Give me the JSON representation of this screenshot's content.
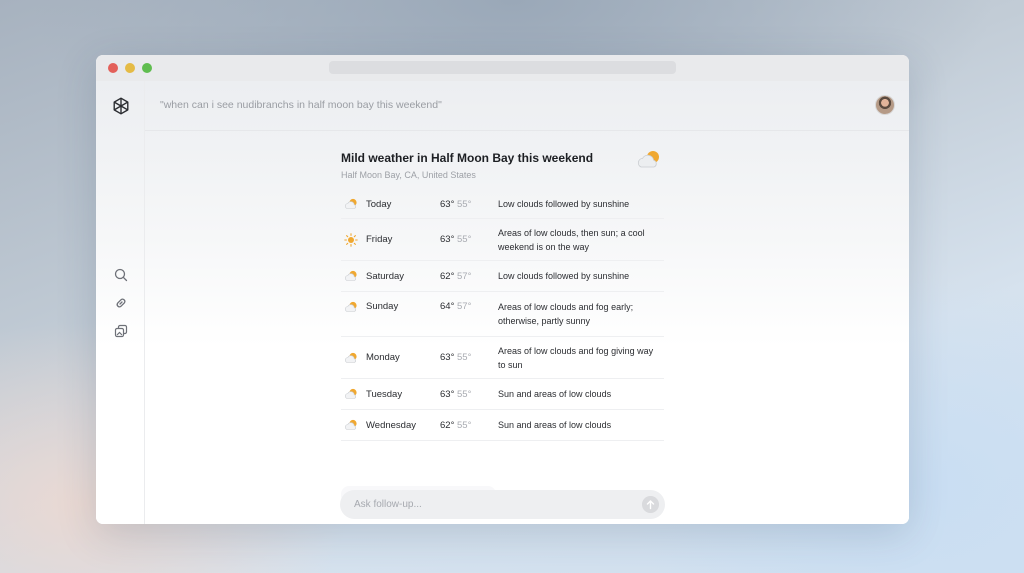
{
  "app": {
    "query": "\"when can i see nudibranchs in half moon bay this weekend\""
  },
  "weather": {
    "title": "Mild weather in Half Moon Bay this weekend",
    "location": "Half Moon Bay, CA, United States",
    "days": [
      {
        "day": "Today",
        "hi": "63°",
        "lo": "55°",
        "desc": "Low clouds followed by sunshine",
        "icon": "partly-cloudy-icon"
      },
      {
        "day": "Friday",
        "hi": "63°",
        "lo": "55°",
        "desc": "Areas of low clouds, then sun; a cool weekend is on the way",
        "icon": "sun-icon"
      },
      {
        "day": "Saturday",
        "hi": "62°",
        "lo": "57°",
        "desc": "Low clouds followed by sunshine",
        "icon": "partly-cloudy-icon"
      },
      {
        "day": "Sunday",
        "hi": "64°",
        "lo": "57°",
        "desc": "Areas of low clouds and fog early; otherwise, partly sunny",
        "icon": "partly-cloudy-icon"
      },
      {
        "day": "Monday",
        "hi": "63°",
        "lo": "55°",
        "desc": "Areas of low clouds and fog giving way to sun",
        "icon": "partly-cloudy-icon"
      },
      {
        "day": "Tuesday",
        "hi": "63°",
        "lo": "55°",
        "desc": "Sun and areas of low clouds",
        "icon": "partly-cloudy-icon"
      },
      {
        "day": "Wednesday",
        "hi": "62°",
        "lo": "55°",
        "desc": "Sun and areas of low clouds",
        "icon": "partly-cloudy-icon"
      }
    ]
  },
  "followup": {
    "placeholder": "Ask follow-up..."
  },
  "colors": {
    "sun": "#f0a830",
    "cloud": "#d8dadd"
  }
}
